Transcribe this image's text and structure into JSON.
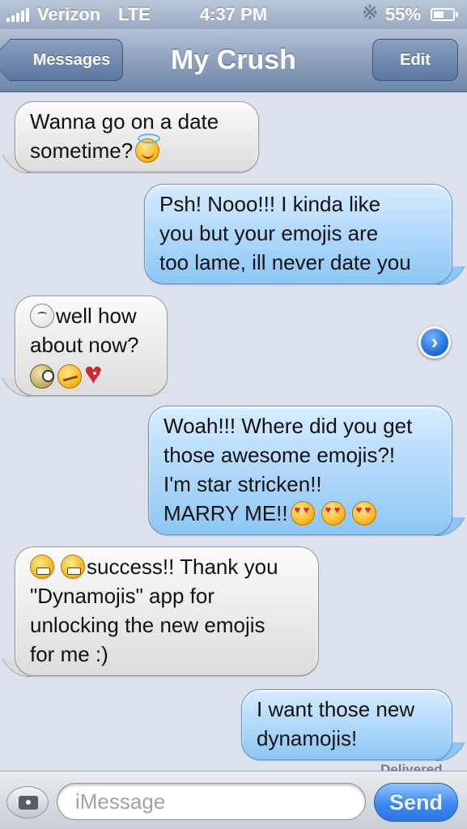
{
  "status_bar": {
    "carrier": "Verizon",
    "network": "LTE",
    "time": "4:37 PM",
    "battery_percent": "55%",
    "battery_level": 0.55
  },
  "nav": {
    "back_label": "Messages",
    "title": "My Crush",
    "edit_label": "Edit"
  },
  "messages": [
    {
      "direction": "incoming",
      "lines": [
        "Wanna go on a date",
        "sometime?"
      ],
      "emojis": [
        "angel-icon"
      ]
    },
    {
      "direction": "outgoing",
      "lines": [
        "Psh! Nooo!!! I kinda like",
        "you but your emojis are",
        "too lame, ill never date you"
      ]
    },
    {
      "direction": "incoming",
      "lines": [
        "well how",
        "about now?"
      ],
      "emojis": [
        "plain-face-icon",
        "monocle-face-icon",
        "smirk-face-icon",
        "heart-face-icon"
      ]
    },
    {
      "direction": "outgoing",
      "lines": [
        "Woah!!! Where did you get",
        "those awesome emojis?!",
        "I'm star stricken!!",
        "MARRY ME!!"
      ],
      "emojis": [
        "heart-eyes-icon",
        "heart-eyes-icon",
        "heart-eyes-icon"
      ]
    },
    {
      "direction": "incoming",
      "lines": [
        "success!! Thank you",
        "\"Dynamojis\" app for",
        "unlocking the new emojis",
        "for me :)"
      ],
      "emojis": [
        "grin-icon",
        "grin-icon"
      ]
    },
    {
      "direction": "outgoing",
      "lines": [
        "I want those new",
        "dynamojis!"
      ]
    }
  ],
  "delivered_label": "Delivered",
  "input": {
    "placeholder": "iMessage",
    "send_label": "Send"
  },
  "colors": {
    "incoming_bubble": "#e8e8e8",
    "outgoing_bubble": "#a9d5fa",
    "background": "#dbe2ed",
    "send_button": "#3e8af0"
  }
}
